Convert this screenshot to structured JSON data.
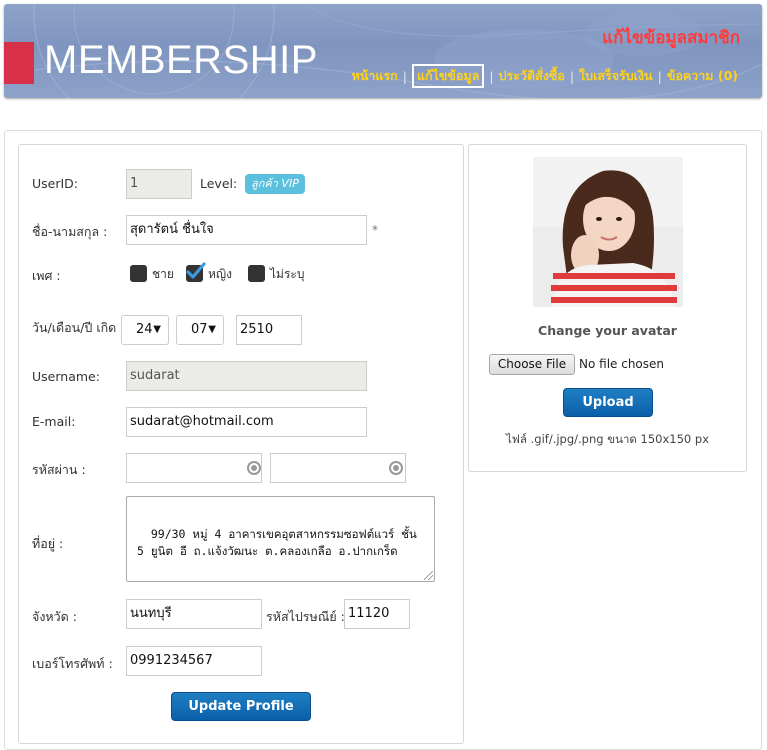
{
  "header": {
    "logo": "MEMBERSHIP",
    "page_heading": "แก้ไขข้อมูลสมาชิก",
    "nav": [
      {
        "label": "หน้าแรก",
        "active": false
      },
      {
        "label": "แก้ไขข้อมูล",
        "active": true
      },
      {
        "label": "ประวัติสั่งซื้อ",
        "active": false
      },
      {
        "label": "ใบเสร็จรับเงิน",
        "active": false
      },
      {
        "label": "ข้อความ (0)",
        "active": false
      }
    ],
    "nav_separator": "|"
  },
  "form": {
    "userid_label": "UserID:",
    "userid_value": "1",
    "level_label": "Level:",
    "level_value": "ลูกค้า VIP",
    "name_label": "ชื่อ-นามสกุล :",
    "name_value": "สุดารัตน์ ชื่นใจ",
    "required_mark": "*",
    "gender_label": "เพศ :",
    "gender_options": [
      {
        "label": "ชาย",
        "checked": false
      },
      {
        "label": "หญิง",
        "checked": true
      },
      {
        "label": "ไม่ระบุ",
        "checked": false
      }
    ],
    "birthdate_label": "วัน/เดือน/ปี เกิด :",
    "birth_day": "24",
    "birth_month": "07",
    "birth_year": "2510",
    "username_label": "Username:",
    "username_value": "sudarat",
    "email_label": "E-mail:",
    "email_value": "sudarat@hotmail.com",
    "password_label": "รหัสผ่าน :",
    "address_label": "ที่อยู่ :",
    "address_value": "99/30 หมู่ 4 อาคารเขคอุตสาหกรรมซอฟต์แวร์ ชั้น 5 ยูนิต อี ถ.แจ้งวัฒนะ ต.คลองเกลือ อ.ปากเกร็ด",
    "province_label": "จังหวัด :",
    "province_value": "นนทบุรี",
    "postcode_label": "รหัสไปรษณีย์ :",
    "postcode_value": "11120",
    "phone_label": "เบอร์โทรศัพท์ :",
    "phone_value": "0991234567",
    "submit_label": "Update Profile"
  },
  "avatar": {
    "heading": "Change your avatar",
    "choose_file_label": "Choose File",
    "no_file_text": "No file chosen",
    "upload_label": "Upload",
    "hint": "ไฟล์ .gif/.jpg/.png ขนาด 150x150 px"
  },
  "colors": {
    "nav_text": "#ffd21a",
    "heading_red": "#ff3b3b",
    "badge": "#5bc0de",
    "button_blue": "#0a5fa8"
  }
}
